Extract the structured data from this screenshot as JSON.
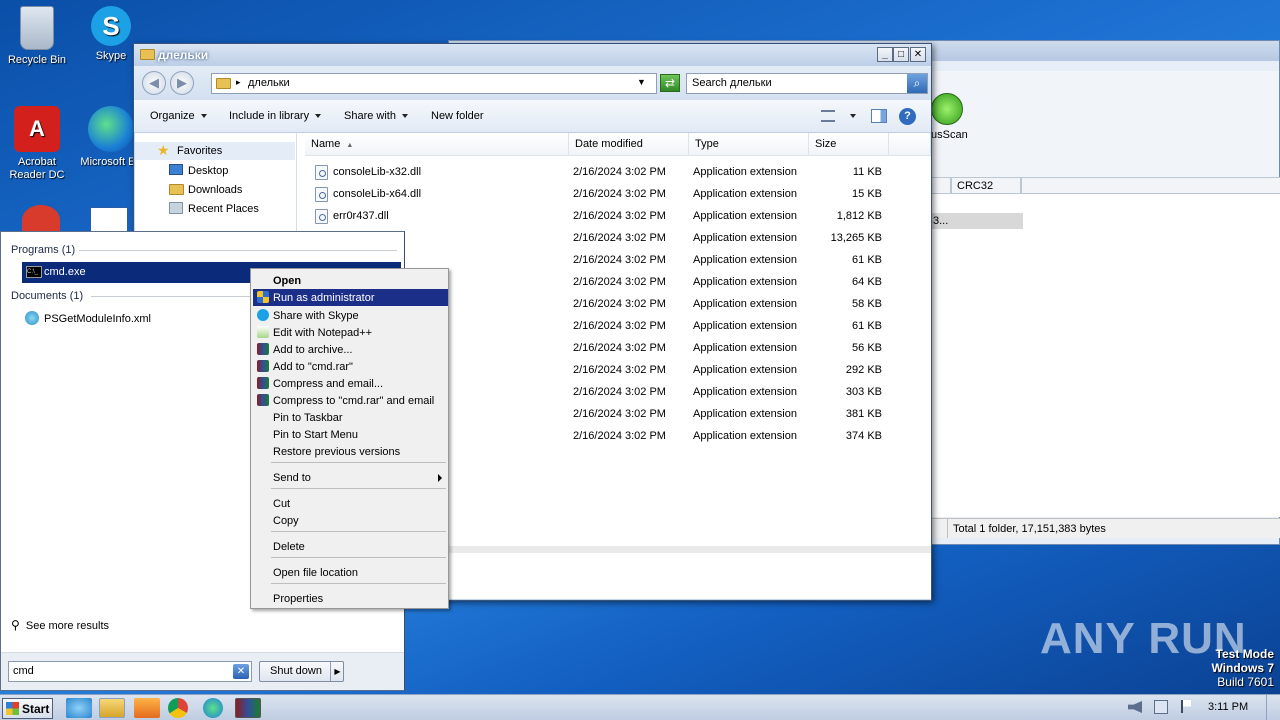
{
  "desktop": {
    "icons": [
      {
        "label": "Recycle Bin"
      },
      {
        "label": "Skype"
      },
      {
        "label": "Acrobat Reader DC"
      },
      {
        "label": "Microsoft Ed"
      }
    ]
  },
  "bg_window": {
    "toolbar_label": "usScan",
    "column_crc32": "CRC32",
    "row_fragment": "3...",
    "status": "Total 1 folder, 17,151,383 bytes"
  },
  "explorer": {
    "title": "длельки",
    "address": "длельки",
    "search_placeholder": "Search длельки",
    "commands": {
      "organize": "Organize",
      "include": "Include in library",
      "share": "Share with",
      "new_folder": "New folder"
    },
    "nav": {
      "favorites": "Favorites",
      "desktop": "Desktop",
      "downloads": "Downloads",
      "recent": "Recent Places"
    },
    "columns": {
      "name": "Name",
      "date": "Date modified",
      "type": "Type",
      "size": "Size"
    },
    "files": [
      {
        "name": "consoleLib-x32.dll",
        "date": "2/16/2024 3:02 PM",
        "type": "Application extension",
        "size": "11 KB"
      },
      {
        "name": "consoleLib-x64.dll",
        "date": "2/16/2024 3:02 PM",
        "type": "Application extension",
        "size": "15 KB"
      },
      {
        "name": "err0r437.dll",
        "date": "2/16/2024 3:02 PM",
        "type": "Application extension",
        "size": "1,812 KB"
      },
      {
        "name": "",
        "date": "2/16/2024 3:02 PM",
        "type": "Application extension",
        "size": "13,265 KB"
      },
      {
        "name": "",
        "date": "2/16/2024 3:02 PM",
        "type": "Application extension",
        "size": "61 KB"
      },
      {
        "name": "",
        "date": "2/16/2024 3:02 PM",
        "type": "Application extension",
        "size": "64 KB"
      },
      {
        "name": "",
        "date": "2/16/2024 3:02 PM",
        "type": "Application extension",
        "size": "58 KB"
      },
      {
        "name": "",
        "date": "2/16/2024 3:02 PM",
        "type": "Application extension",
        "size": "61 KB"
      },
      {
        "name": "",
        "date": "2/16/2024 3:02 PM",
        "type": "Application extension",
        "size": "56 KB"
      },
      {
        "name": "",
        "date": "2/16/2024 3:02 PM",
        "type": "Application extension",
        "size": "292 KB"
      },
      {
        "name": "",
        "date": "2/16/2024 3:02 PM",
        "type": "Application extension",
        "size": "303 KB"
      },
      {
        "name": "",
        "date": "2/16/2024 3:02 PM",
        "type": "Application extension",
        "size": "381 KB"
      },
      {
        "name": "",
        "date": "2/16/2024 3:02 PM",
        "type": "Application extension",
        "size": "374 KB"
      }
    ]
  },
  "start_menu": {
    "programs_header": "Programs (1)",
    "program_item": "cmd.exe",
    "documents_header": "Documents (1)",
    "document_item": "PSGetModuleInfo.xml",
    "see_more": "See more results",
    "search_value": "cmd",
    "shutdown": "Shut down"
  },
  "context_menu": {
    "items": [
      {
        "label": "Open",
        "bold": true
      },
      {
        "label": "Run as administrator",
        "highlighted": true
      },
      {
        "label": "Share with Skype"
      },
      {
        "label": "Edit with Notepad++"
      },
      {
        "label": "Add to archive..."
      },
      {
        "label": "Add to \"cmd.rar\""
      },
      {
        "label": "Compress and email..."
      },
      {
        "label": "Compress to \"cmd.rar\" and email"
      },
      {
        "label": "Pin to Taskbar"
      },
      {
        "label": "Pin to Start Menu"
      },
      {
        "label": "Restore previous versions"
      },
      {
        "label": "Send to"
      },
      {
        "label": "Cut"
      },
      {
        "label": "Copy"
      },
      {
        "label": "Delete"
      },
      {
        "label": "Open file location"
      },
      {
        "label": "Properties"
      }
    ]
  },
  "taskbar": {
    "start": "Start",
    "clock": "3:11 PM"
  },
  "watermark": {
    "brand": "ANY RUN",
    "line1": "Test Mode",
    "line2": "Windows 7",
    "line3": "Build 7601"
  },
  "colors": {
    "selection": "#0b2a7a",
    "menu_highlight": "#1b2f89",
    "desktop": "#1c6fd0"
  }
}
